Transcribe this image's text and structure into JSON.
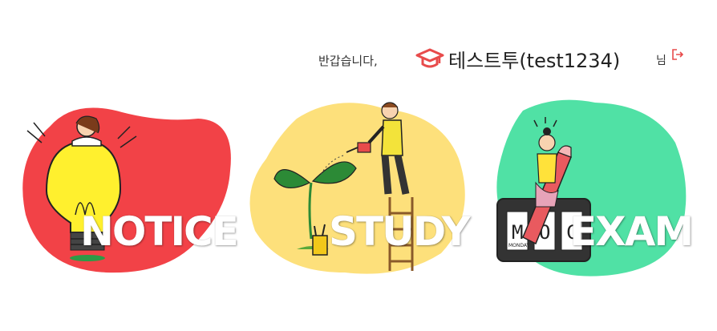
{
  "header": {
    "greeting": "반갑습니다,",
    "user_name": "테스트투(test1234)",
    "suffix": "님"
  },
  "menu": [
    {
      "label": "NOTICE",
      "color": "#f24247"
    },
    {
      "label": "STUDY",
      "color": "#fde07b"
    },
    {
      "label": "EXAM",
      "color": "#50e1a5"
    }
  ],
  "calendar_text": {
    "left": "M",
    "mid": "O",
    "right": "C",
    "day": "MONDAY"
  },
  "icons": [
    "graduation-cap-icon",
    "logout-icon",
    "lightbulb-icon",
    "watering-can-icon",
    "calendar-icon",
    "pencil-icon"
  ]
}
